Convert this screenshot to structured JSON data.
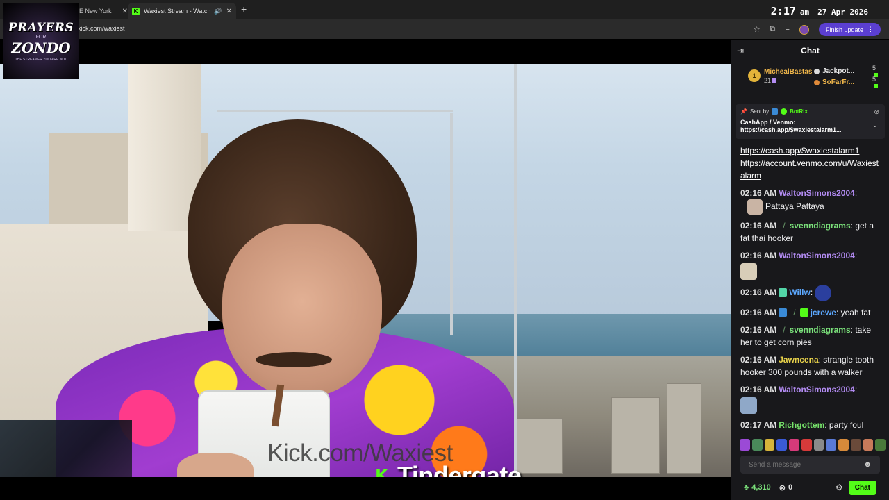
{
  "browser": {
    "tabs": [
      {
        "title": "E New York"
      },
      {
        "title": "Waxiest Stream - Watch Live"
      }
    ],
    "url": "kick.com/waxiest",
    "finish_update": "Finish update",
    "clock": {
      "time": "2:17",
      "ampm": "am",
      "date": "27 Apr 2026"
    }
  },
  "logo": {
    "line1": "PRAYERS",
    "line2": "FOR",
    "line3": "ZONDO",
    "tagline": "THE STREAMER YOU ARE NOT"
  },
  "stream": {
    "watermark": "Kick.com/Waxiest",
    "brand_name": "Tindergate"
  },
  "chat": {
    "title": "Chat",
    "leaderboard": {
      "rank": "1",
      "top_user": "MichealBastas",
      "top_count": "21",
      "others": [
        {
          "name": "Jackpot...",
          "count": "5",
          "color": "#e9e9e9"
        },
        {
          "name": "SoFarFr...",
          "count": "5",
          "color": "#f2b84b"
        }
      ]
    },
    "pinned": {
      "sent_by_label": "Sent by",
      "bot": "BotRix",
      "line": "CashApp / Venmo:",
      "link": "https://cash.app/$waxiestalarm1..."
    },
    "messages": [
      {
        "links": [
          "https://cash.app/$waxiestalarm1",
          "https://account.venmo.com/u/Waxiestalarm"
        ]
      },
      {
        "time": "02:16 AM",
        "user": "WaltonSimons2004",
        "text": "Pattaya Pattaya",
        "color": "purple"
      },
      {
        "time": "02:16 AM",
        "user": "svenndiagrams",
        "text": "get a fat thai hooker",
        "color": "green"
      },
      {
        "time": "02:16 AM",
        "user": "WaltonSimons2004",
        "text": "",
        "color": "purple"
      },
      {
        "time": "02:16 AM",
        "user": "Willw",
        "text": "",
        "color": "blue"
      },
      {
        "time": "02:16 AM",
        "user": "jcrewe",
        "text": "yeah fat",
        "color": "blue"
      },
      {
        "time": "02:16 AM",
        "user": "svenndiagrams",
        "text": "take her to get corn pies",
        "color": "green"
      },
      {
        "time": "02:16 AM",
        "user": "Jawncena",
        "text": "strangle tooth hooker 300 pounds with a walker",
        "color": "yellow"
      },
      {
        "time": "02:16 AM",
        "user": "WaltonSimons2004",
        "text": "",
        "color": "purple"
      },
      {
        "time": "02:17 AM",
        "user": "Richgottem",
        "text": "party foul",
        "color": "lime"
      }
    ],
    "input_placeholder": "Send a message",
    "kicks": "4,310",
    "zero": "0",
    "chat_button": "Chat"
  }
}
